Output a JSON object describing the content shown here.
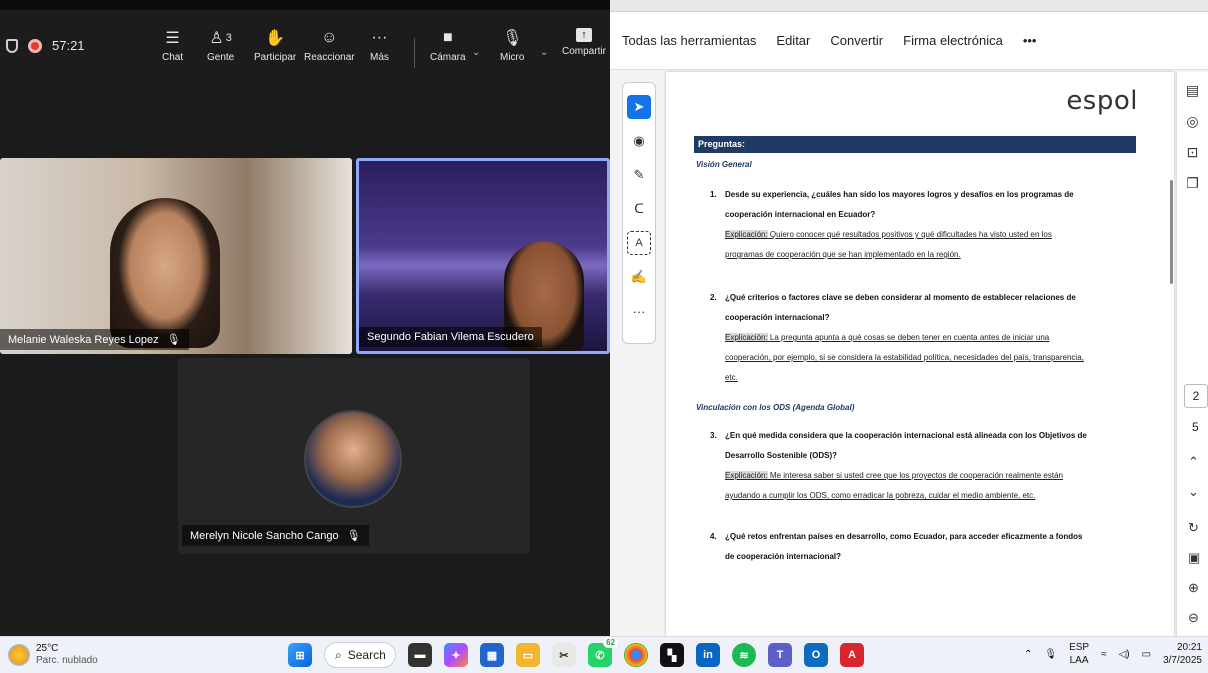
{
  "zoom": {
    "timer": "57:21",
    "toolbar": [
      {
        "label": "Chat",
        "icon": "chat-icon",
        "glyph": "☺"
      },
      {
        "label": "Gente",
        "icon": "people-icon",
        "glyph": "👥",
        "count": "3"
      },
      {
        "label": "Participar",
        "icon": "raise-hand-icon",
        "glyph": "✋"
      },
      {
        "label": "Reaccionar",
        "icon": "smile-icon",
        "glyph": "☺"
      },
      {
        "label": "Más",
        "icon": "more-icon",
        "glyph": "···"
      },
      {
        "label": "Cámara",
        "icon": "camera-icon",
        "glyph": "■"
      },
      {
        "label": "Micro",
        "icon": "mic-muted-icon",
        "glyph": "🎙"
      },
      {
        "label": "Compartir",
        "icon": "share-icon",
        "glyph": "↑"
      }
    ],
    "participants": [
      {
        "name": "Melanie Waleska Reyes Lopez"
      },
      {
        "name": "Segundo Fabian Vilema Escudero"
      },
      {
        "name": "Merelyn Nicole Sancho Cango"
      }
    ]
  },
  "pdf": {
    "menu": [
      "Todas las herramientas",
      "Editar",
      "Convertir",
      "Firma electrónica",
      "•••"
    ],
    "logo": "espol",
    "heading": "Preguntas:",
    "sections": [
      {
        "title": "Visión General"
      },
      {
        "title": "Vinculación con los ODS (Agenda Global)"
      }
    ],
    "questions": [
      {
        "num": "1.",
        "line1": "Desde su experiencia, ¿cuáles han sido los mayores logros y desafíos en los programas de",
        "line2": "cooperación internacional en Ecuador?",
        "ex_label": "Explicación:",
        "ex_line1": " Quiero conocer qué resultados positivos y qué dificultades ha visto usted en los",
        "ex_line2": "programas de cooperación que se han implementado en la región."
      },
      {
        "num": "2.",
        "line1": "¿Qué criterios o factores clave se deben considerar al momento de establecer relaciones de",
        "line2": "cooperación internacional?",
        "ex_label": "Explicación:",
        "ex_line1": " La pregunta apunta a qué cosas se deben tener en cuenta antes de iniciar una",
        "ex_line2": "cooperación, por ejemplo, si se considera la estabilidad política, necesidades del país, transparencia,",
        "ex_line3": "etc."
      },
      {
        "num": "3.",
        "line1": "¿En qué medida considera que la cooperación internacional está alineada con los Objetivos de",
        "line2": "Desarrollo Sostenible (ODS)?",
        "ex_label": "Explicación:",
        "ex_line1": " Me interesa saber si usted cree que los proyectos de cooperación realmente están",
        "ex_line2": "ayudando a cumplir los ODS, como erradicar la pobreza, cuidar el medio ambiente, etc."
      },
      {
        "num": "4.",
        "line1": "¿Qué retos enfrentan países en desarrollo, como Ecuador, para acceder eficazmente a fondos",
        "line2": "de cooperación internacional?"
      }
    ],
    "page_current": "2",
    "page_total": "5"
  },
  "taskbar": {
    "temp": "25°C",
    "weather": "Parc. nublado",
    "search": "Search",
    "whatsapp_badge": "62",
    "lang1": "ESP",
    "lang2": "LAA",
    "time": "20:21",
    "date": "3/7/2025"
  },
  "colors": {
    "accent": "#1473e6",
    "heading_bar": "#1f3a64",
    "record": "#e53935"
  }
}
